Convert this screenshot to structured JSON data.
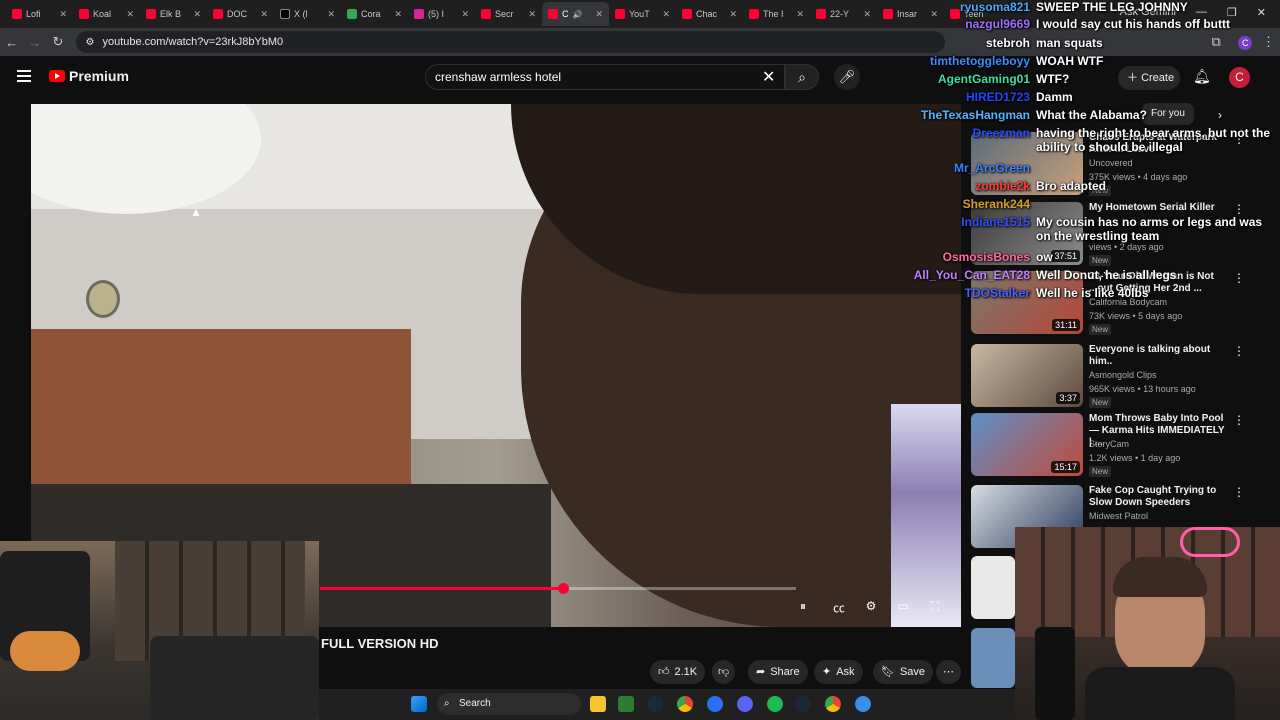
{
  "browser": {
    "tabs": [
      {
        "label": "Lofi"
      },
      {
        "label": "Koal"
      },
      {
        "label": "Elk B"
      },
      {
        "label": "DOC"
      },
      {
        "label": "X (l"
      },
      {
        "label": "Cora"
      },
      {
        "label": "(5) I"
      },
      {
        "label": "Secr"
      },
      {
        "label": "C"
      },
      {
        "label": "YouT"
      },
      {
        "label": "Chac"
      },
      {
        "label": "The I"
      },
      {
        "label": "22-Y"
      },
      {
        "label": "Insar"
      },
      {
        "label": "Teen"
      }
    ],
    "ask_gemini": "Ask Gemini",
    "url": "youtube.com/watch?v=23rkJ8bYbM0"
  },
  "youtube": {
    "brand": "Premium",
    "search_value": "crenshaw armless hotel",
    "create_label": "Create",
    "avatar_letter": "C",
    "chips": [
      "For you"
    ]
  },
  "video": {
    "title": "FULL VERSION HD",
    "progress": 0.51,
    "actions": {
      "like_count": "2.1K",
      "share_label": "Share",
      "ask_label": "Ask",
      "save_label": "Save"
    }
  },
  "recommendations": [
    {
      "title": "Chaos Erupts at Waterpark After ... Leave",
      "channel": "Uncovered",
      "meta": "375K views • 4 days ago",
      "badge": "New",
      "duration": ""
    },
    {
      "title": "My Hometown Serial Killer",
      "channel": "",
      "meta": "views • 2 days ago",
      "badge": "New",
      "duration": "37:51"
    },
    {
      "title": "23-Year-Old Woman is Not ...out Getting Her 2nd ...",
      "channel": "California Bodycam",
      "meta": "73K views • 5 days ago",
      "badge": "New",
      "duration": "31:11"
    },
    {
      "title": "Everyone is talking about him..",
      "channel": "Asmongold Clips",
      "meta": "965K views • 13 hours ago",
      "badge": "New",
      "duration": "3:37"
    },
    {
      "title": "Mom Throws Baby Into Pool — Karma Hits IMMEDIATELY | ...",
      "channel": "StoryCam",
      "meta": "1.2K views • 1 day ago",
      "badge": "New",
      "duration": "15:17"
    },
    {
      "title": "Fake Cop Caught Trying to Slow Down Speeders",
      "channel": "Midwest Patrol",
      "meta": "",
      "badge": "",
      "duration": ""
    }
  ],
  "chat": [
    {
      "name": "ryusoma821",
      "message": "SWEEP THE LEG JOHNNY",
      "name_color": "#4aa8ff"
    },
    {
      "name": "nazgul9669",
      "message": "I would say cut his hands off buttt",
      "name_color": "#a070ff"
    },
    {
      "name": "stebroh",
      "message": "man squats",
      "name_color": "#ffffff"
    },
    {
      "name": "timthetoggleboyy",
      "message": "WOAH WTF",
      "name_color": "#3b8eff"
    },
    {
      "name": "AgentGaming01",
      "message": "WTF?",
      "name_color": "#3be0a0"
    },
    {
      "name": "HIRED1723",
      "message": "Damm",
      "name_color": "#2244ff"
    },
    {
      "name": "TheTexasHangman",
      "message": "What the Alabama?",
      "name_color": "#58b4ff"
    },
    {
      "name": "Dreezman",
      "message": "having the right to bear arms, but not the ability to should be illegal",
      "name_color": "#2a4cff"
    },
    {
      "name": "Mr_ArcGreen",
      "message": "",
      "name_color": "#4080ff"
    },
    {
      "name": "zombie2k",
      "message": "Bro adapted",
      "name_color": "#ff3b3b"
    },
    {
      "name": "Sherank244",
      "message": "",
      "name_color": "#d4a020"
    },
    {
      "name": "Indiane1515",
      "message": "My cousin has no arms or legs and was on the wrestling team",
      "name_color": "#3050ff"
    },
    {
      "name": "OsmosisBones",
      "message": "ow",
      "name_color": "#ff6aa0"
    },
    {
      "name": "All_You_Can_EAT28",
      "message": "Well Donut, he is all legs",
      "name_color": "#c080ff"
    },
    {
      "name": "TDOStalker",
      "message": "Well he is like 40lbs",
      "name_color": "#4a60ff"
    }
  ],
  "taskbar": {
    "search_label": "Search"
  },
  "colors": {
    "accent": "#ff0033",
    "background": "#0f0f0f",
    "chip": "#272727"
  }
}
